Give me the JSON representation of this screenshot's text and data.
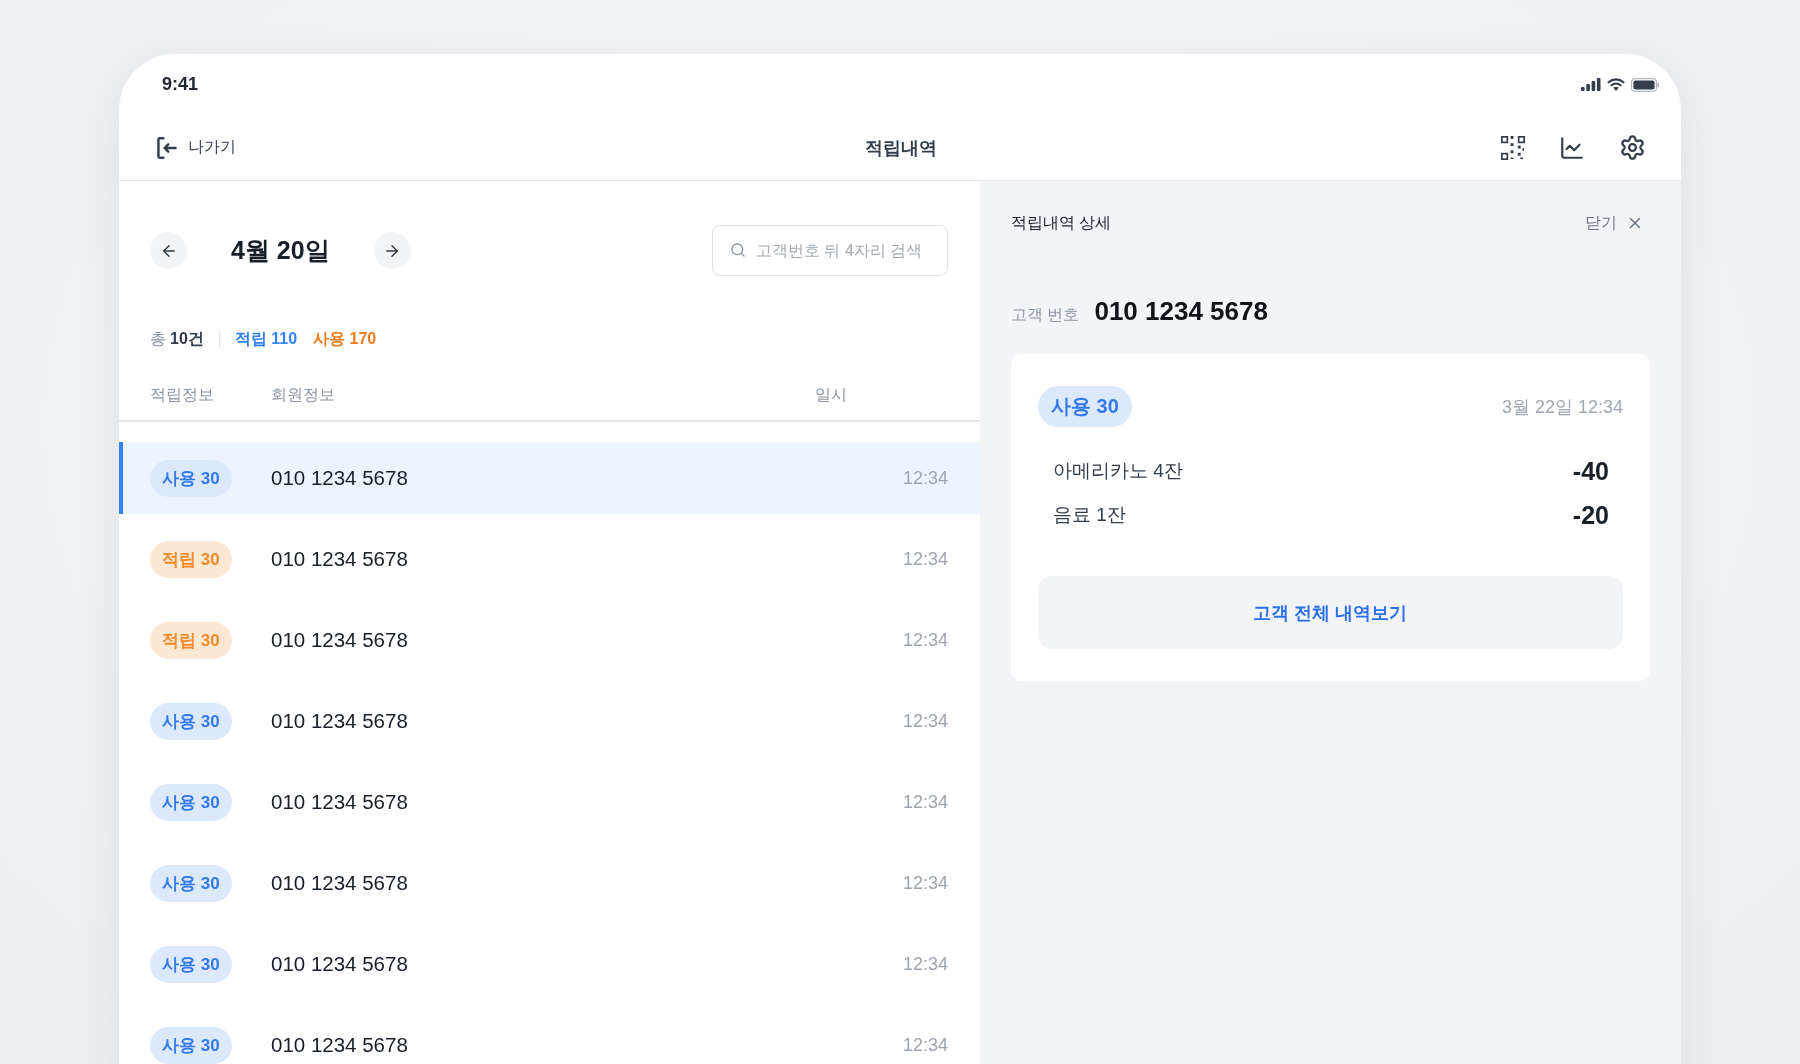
{
  "status_bar": {
    "time": "9:41"
  },
  "nav": {
    "back_label": "나가기",
    "title": "적립내역"
  },
  "date_nav": {
    "date": "4월 20일"
  },
  "search": {
    "placeholder": "고객번호 뒤 4자리 검색"
  },
  "summary": {
    "total_prefix": "총",
    "total_count": "10건",
    "stats": [
      {
        "label": "적립 110",
        "color": "#3182f6"
      },
      {
        "label": "사용 170",
        "color": "#f07c1e"
      }
    ]
  },
  "table": {
    "columns": [
      "적립정보",
      "회원정보",
      "일시"
    ],
    "rows": [
      {
        "kind": "use",
        "badge": "사용 30",
        "phone": "010 1234 5678",
        "time": "12:34",
        "selected": true
      },
      {
        "kind": "earn",
        "badge": "적립 30",
        "phone": "010 1234 5678",
        "time": "12:34",
        "selected": false
      },
      {
        "kind": "earn",
        "badge": "적립 30",
        "phone": "010 1234 5678",
        "time": "12:34",
        "selected": false
      },
      {
        "kind": "use",
        "badge": "사용 30",
        "phone": "010 1234 5678",
        "time": "12:34",
        "selected": false
      },
      {
        "kind": "use",
        "badge": "사용 30",
        "phone": "010 1234 5678",
        "time": "12:34",
        "selected": false
      },
      {
        "kind": "use",
        "badge": "사용 30",
        "phone": "010 1234 5678",
        "time": "12:34",
        "selected": false
      },
      {
        "kind": "use",
        "badge": "사용 30",
        "phone": "010 1234 5678",
        "time": "12:34",
        "selected": false
      },
      {
        "kind": "use",
        "badge": "사용 30",
        "phone": "010 1234 5678",
        "time": "12:34",
        "selected": false
      }
    ]
  },
  "detail": {
    "title": "적립내역 상세",
    "close_label": "닫기",
    "customer_label": "고객 번호",
    "customer_number": "010 1234 5678",
    "record": {
      "kind": "use",
      "badge": "사용 30",
      "datetime": "3월 22일 12:34",
      "items": [
        {
          "name": "아메리카노 4잔",
          "points": "-40"
        },
        {
          "name": "음료 1잔",
          "points": "-20"
        }
      ]
    },
    "button": "고객 전체 내역보기"
  }
}
